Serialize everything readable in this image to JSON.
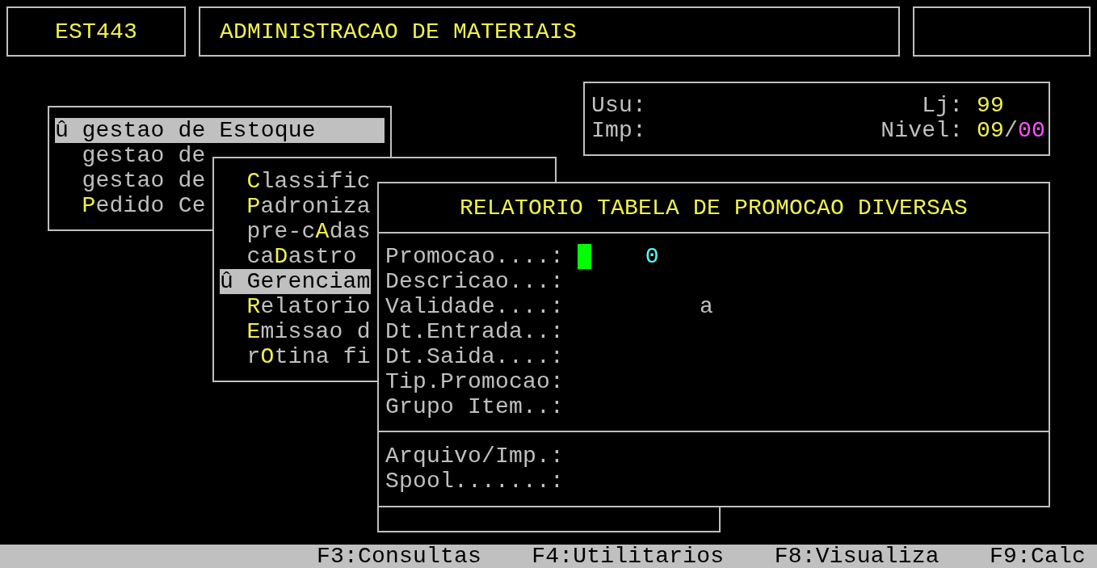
{
  "header": {
    "program_code": "EST443",
    "title": "ADMINISTRACAO DE MATERIAIS"
  },
  "session": {
    "user_label": "Usu:",
    "printer_label": "Imp:",
    "store_label": "Lj:",
    "store": "99",
    "level_label": "Nivel:",
    "level_current": "09",
    "level_separator": "/",
    "level_max": "00"
  },
  "main_menu": {
    "items": [
      {
        "marker": "û",
        "before": "gestao de Estoque",
        "selected": true
      },
      {
        "before": "gestao de",
        "selected": false
      },
      {
        "before": "gestao de",
        "selected": false
      },
      {
        "hotkey": "P",
        "after": "edido Ce",
        "selected": false
      }
    ]
  },
  "submenu": {
    "items": [
      {
        "hotkey": "C",
        "after": "lassific",
        "selected": false
      },
      {
        "hotkey": "P",
        "after": "adroniza",
        "selected": false
      },
      {
        "before": "pre-c",
        "hotkey": "A",
        "after": "das",
        "selected": false
      },
      {
        "before": "ca",
        "hotkey": "D",
        "after": "astro",
        "selected": false
      },
      {
        "marker": "û",
        "before": "Gerenciam",
        "selected": true
      },
      {
        "hotkey": "R",
        "after": "elatorio",
        "selected": false
      },
      {
        "hotkey": "E",
        "after": "missao d",
        "selected": false
      },
      {
        "before": "r",
        "hotkey": "O",
        "after": "tina fi",
        "selected": false
      }
    ]
  },
  "dialog": {
    "title": "RELATORIO TABELA DE PROMOCAO DIVERSAS",
    "fields": [
      {
        "label": "Promocao....:",
        "kind": "number",
        "value": "0",
        "cursor": true
      },
      {
        "label": "Descricao...:",
        "cursor": false
      },
      {
        "label": "Validade....:",
        "kind": "date_range",
        "value": "a",
        "cursor": false
      },
      {
        "label": "Dt.Entrada..:",
        "cursor": false
      },
      {
        "label": "Dt.Saida....:",
        "cursor": false
      },
      {
        "label": "Tip.Promocao:",
        "cursor": false
      },
      {
        "label": "Grupo Item..:",
        "cursor": false
      }
    ],
    "output_fields": [
      {
        "label": "Arquivo/Imp.:"
      },
      {
        "label": "Spool.......:"
      }
    ]
  },
  "status_bar": {
    "keys": [
      "F3:Consultas",
      "F4:Utilitarios",
      "F8:Visualiza",
      "F9:Calc"
    ]
  }
}
